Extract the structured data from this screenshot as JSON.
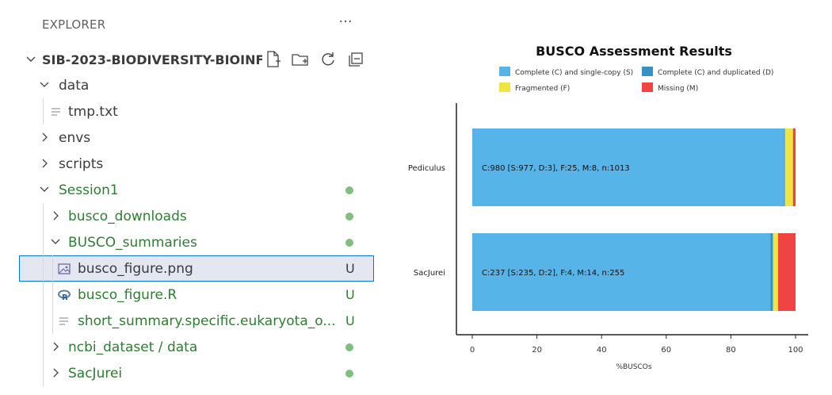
{
  "explorer": {
    "title": "EXPLORER",
    "more_label": "···",
    "project": "SIB-2023-BIODIVERSITY-BIOINF...",
    "items": [
      {
        "label": "data",
        "type": "folder-open"
      },
      {
        "label": "tmp.txt",
        "type": "file-text"
      },
      {
        "label": "envs",
        "type": "folder-closed"
      },
      {
        "label": "scripts",
        "type": "folder-closed"
      },
      {
        "label": "Session1",
        "type": "folder-open",
        "status": "dot"
      },
      {
        "label": "busco_downloads",
        "type": "folder-closed",
        "status": "dot"
      },
      {
        "label": "BUSCO_summaries",
        "type": "folder-open",
        "status": "dot"
      },
      {
        "label": "busco_figure.png",
        "type": "file-image",
        "status": "U"
      },
      {
        "label": "busco_figure.R",
        "type": "file-r",
        "status": "U"
      },
      {
        "label": "short_summary.specific.eukaryota_o...",
        "type": "file-text",
        "status": "U"
      },
      {
        "label": "ncbi_dataset / data",
        "type": "folder-closed",
        "status": "dot"
      },
      {
        "label": "SacJurei",
        "type": "folder-closed",
        "status": "dot"
      }
    ],
    "status_u": "U",
    "colors": {
      "modified": "#2e7d32",
      "dot": "#7fbf7f",
      "selection_border": "#0078d4",
      "selection_bg": "#e4e6f1"
    }
  },
  "chart_data": {
    "type": "bar",
    "orientation": "horizontal-stacked",
    "title": "BUSCO Assessment Results",
    "xlabel": "%BUSCOs",
    "xlim": [
      0,
      100
    ],
    "xticks": [
      "0",
      "20",
      "40",
      "60",
      "80",
      "100"
    ],
    "categories": [
      "Pediculus",
      "SacJurei"
    ],
    "series": [
      {
        "name": "Complete (C) and single-copy (S)",
        "color": "#56b4e9",
        "values": [
          96.4,
          92.2
        ]
      },
      {
        "name": "Complete (C) and duplicated (D)",
        "color": "#3492c7",
        "values": [
          0.3,
          0.8
        ]
      },
      {
        "name": "Fragmented (F)",
        "color": "#f0e442",
        "values": [
          2.5,
          1.6
        ]
      },
      {
        "name": "Missing (M)",
        "color": "#f04442",
        "values": [
          0.8,
          5.4
        ]
      }
    ],
    "bar_labels": [
      "C:980 [S:977, D:3], F:25, M:8, n:1013",
      "C:237 [S:235, D:2], F:4, M:14, n:255"
    ],
    "legend_placement": "top"
  }
}
